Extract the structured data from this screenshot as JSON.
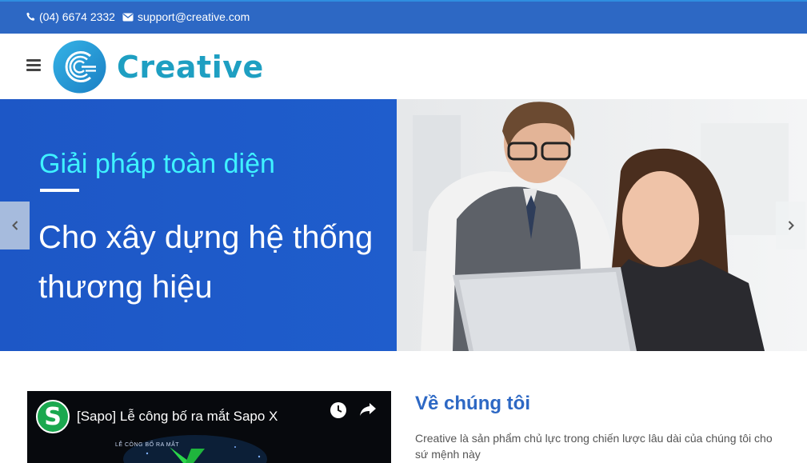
{
  "topbar": {
    "phone": "(04) 6674 2332",
    "email": "support@creative.com",
    "phone_icon": "phone-icon",
    "email_icon": "envelope-icon",
    "background": "#2d68c4"
  },
  "header": {
    "menu_icon": "hamburger-menu-icon",
    "logo_text": "Creative",
    "logo_color": "#1e9fc2"
  },
  "hero": {
    "subtitle": "Giải pháp toàn diện",
    "title": "Cho xây dựng hệ thống thương hiệu",
    "subtitle_color": "#3ff2ff",
    "panel_color": "#1d57c6",
    "prev_icon": "chevron-left-icon",
    "next_icon": "chevron-right-icon"
  },
  "video": {
    "title": "[Sapo] Lễ công bố ra mắt Sapo X",
    "channel_letter": "S",
    "caption": "LỄ CÔNG BỐ RA MẮT",
    "watch_later_icon": "clock-icon",
    "share_icon": "share-arrow-icon"
  },
  "about": {
    "title": "Về chúng tôi",
    "text": "Creative là sản phẩm chủ lực trong chiến lược lâu dài của chúng tôi cho sứ mệnh này"
  }
}
